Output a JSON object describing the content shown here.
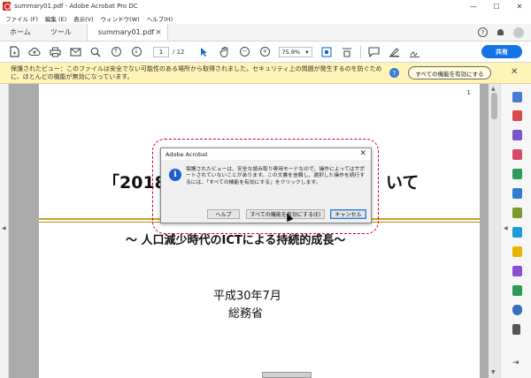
{
  "window": {
    "title": "summary01.pdf - Adobe Acrobat Pro DC",
    "minimize": "—",
    "maximize": "☐",
    "close": "✕"
  },
  "menu": [
    "ファイル (F)",
    "編集 (E)",
    "表示(V)",
    "ウィンドウ(W)",
    "ヘルプ(H)"
  ],
  "tabs": {
    "home": "ホーム",
    "tools": "ツール",
    "document": "summary01.pdf",
    "close": "×"
  },
  "header_icons": {
    "help": "?",
    "notifications": "bell-icon",
    "account": "avatar"
  },
  "toolbar": {
    "page_current": "1",
    "page_total": "/ 12",
    "zoom": "75.9%",
    "share_label": "共有",
    "icons": [
      "create-pdf-icon",
      "upload-cloud-icon",
      "print-icon",
      "email-icon",
      "search-icon",
      "page-up-icon",
      "page-down-icon",
      "select-arrow-icon",
      "hand-icon",
      "zoom-out-icon",
      "zoom-in-icon",
      "fit-page-icon",
      "scroll-mode-icon",
      "comment-icon",
      "highlight-icon",
      "sign-icon"
    ]
  },
  "banner": {
    "message": "保護されたビュー：このファイルは安全でない可能性のある場所から取得されました。セキュリティ上の問題が発生するのを防ぐために、ほとんどの機能が無効になっています。",
    "help": "?",
    "enable_button": "すべての機能を有効にする",
    "close": "✕"
  },
  "document": {
    "page_number": "1",
    "title_left": "「2018",
    "title_right": "いて",
    "subtitle": "～ 人口減少時代のICTによる持続的成長～",
    "date": "平成30年7月",
    "organization": "総務省"
  },
  "dialog": {
    "title": "Adobe Acrobat",
    "close": "✕",
    "info_icon": "i",
    "message": "保護されたビューは、安全な読み取り専用モードなので、操作によってはサポートされていないことがあります。この文書を信頼し、選択した操作を続行するには、「すべての機能を有効にする」をクリックします。",
    "help_button": "ヘルプ",
    "enable_button": "すべての機能を有効にする(E)",
    "cancel_button": "キャンセル"
  },
  "colors": {
    "banner_bg": "#fff4b8",
    "share_blue": "#1473e6",
    "highlight_red": "#d0021b",
    "rule_gold": "#c9a227"
  }
}
